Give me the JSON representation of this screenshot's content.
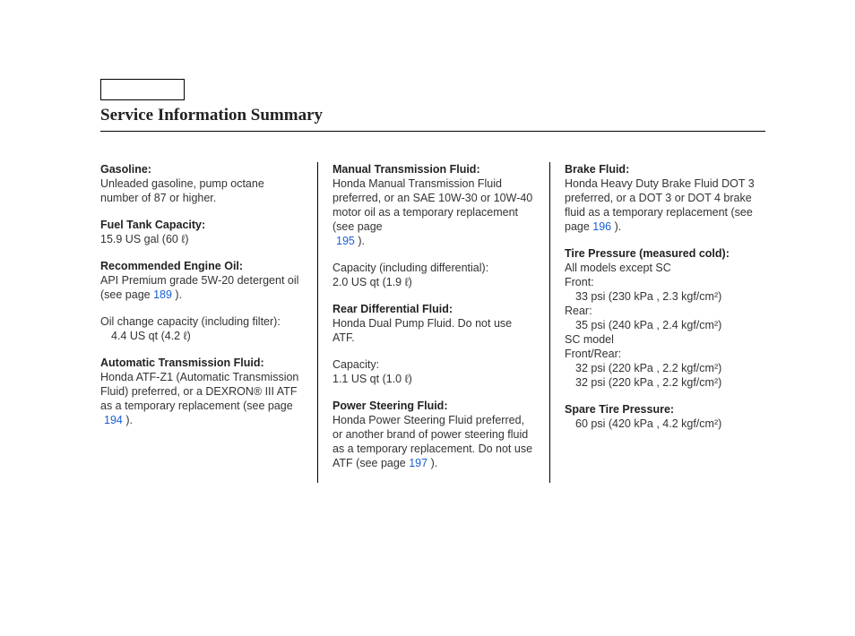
{
  "title": "Service Information Summary",
  "col1": {
    "gasoline_h": "Gasoline:",
    "gasoline_t": "Unleaded gasoline, pump octane number of 87 or higher.",
    "fuel_h": "Fuel Tank Capacity:",
    "fuel_t": "15.9 US gal (60 ℓ)",
    "oil_h": "Recommended Engine Oil:",
    "oil_t1": "API Premium grade 5W-20 detergent oil (see page ",
    "oil_link": "189",
    "oil_t2": " ).",
    "oilcap_t": "Oil change capacity (including filter):",
    "oilcap_v": "4.4 US qt (4.2 ℓ)",
    "atf_h": "Automatic Transmission Fluid:",
    "atf_t1": "Honda ATF-Z1 (Automatic Transmission Fluid) preferred, or a DEXRON® III ATF as a temporary replacement (see page ",
    "atf_link": "194",
    "atf_t2": " )."
  },
  "col2": {
    "mtf_h": "Manual Transmission Fluid:",
    "mtf_t1": "Honda Manual Transmission Fluid preferred, or an SAE 10W-30 or 10W-40 motor oil as a temporary replacement (see page ",
    "mtf_link": "195",
    "mtf_t2": " ).",
    "mtf_cap_t": "Capacity (including differential):",
    "mtf_cap_v": "2.0 US qt (1.9 ℓ)",
    "rdf_h": "Rear Differential Fluid:",
    "rdf_t": "Honda Dual Pump Fluid. Do not use ATF.",
    "rdf_cap_t": "Capacity:",
    "rdf_cap_v": "1.1 US qt (1.0 ℓ)",
    "psf_h": "Power Steering Fluid:",
    "psf_t1": "Honda Power Steering Fluid preferred, or another brand of power steering fluid as a temporary replacement. Do not use ATF (see page ",
    "psf_link": "197",
    "psf_t2": " )."
  },
  "col3": {
    "bf_h": "Brake Fluid:",
    "bf_t1": "Honda Heavy Duty Brake Fluid DOT 3 preferred, or a DOT 3 or DOT 4 brake fluid as a temporary replacement (see page ",
    "bf_link": "196",
    "bf_t2": " ).",
    "tp_h": "Tire Pressure (measured cold):",
    "tp_1": "All models except SC",
    "tp_2": "Front:",
    "tp_3": "33 psi (230 kPa , 2.3 kgf/cm²)",
    "tp_4": "Rear:",
    "tp_5": "35 psi (240 kPa , 2.4 kgf/cm²)",
    "tp_6": "SC model",
    "tp_7": "Front/Rear:",
    "tp_8": "32 psi (220 kPa , 2.2 kgf/cm²)",
    "tp_9": "32 psi (220 kPa , 2.2 kgf/cm²)",
    "sp_h": "Spare Tire Pressure:",
    "sp_v": "60 psi (420 kPa , 4.2 kgf/cm²)"
  }
}
